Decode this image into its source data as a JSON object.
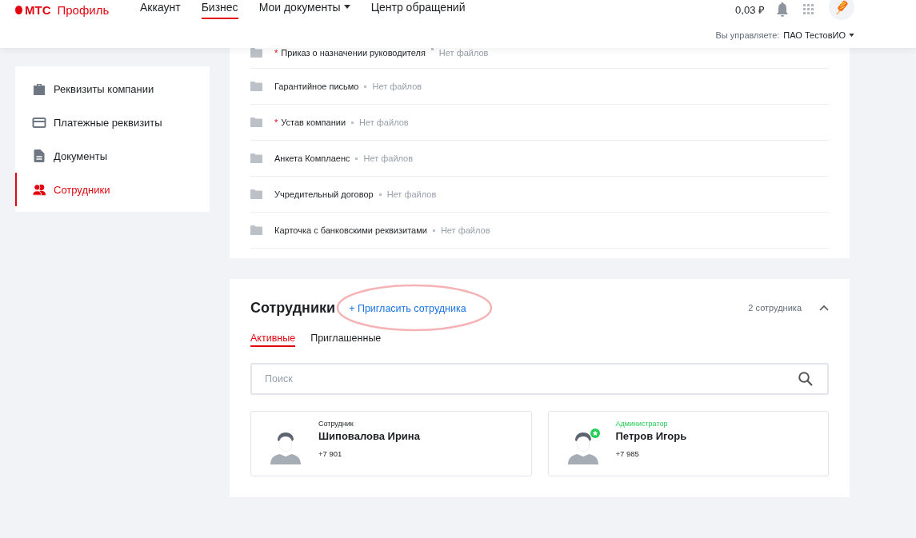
{
  "header": {
    "logo": "МТС",
    "product": "Профиль",
    "nav": [
      {
        "label": "Аккаунт",
        "selected": false,
        "dropdown": false
      },
      {
        "label": "Бизнес",
        "selected": true,
        "dropdown": false
      },
      {
        "label": "Мои документы",
        "selected": false,
        "dropdown": true
      },
      {
        "label": "Центр обращений",
        "selected": false,
        "dropdown": false
      }
    ],
    "balance": "0,03 ₽",
    "manage_label": "Вы управляете:",
    "company": "ПАО ТестовИО"
  },
  "sidebar": {
    "items": [
      {
        "label": "Реквизиты компании",
        "kind": "briefcase",
        "selected": false
      },
      {
        "label": "Платежные реквизиты",
        "kind": "card",
        "selected": false
      },
      {
        "label": "Документы",
        "kind": "document",
        "selected": false
      },
      {
        "label": "Сотрудники",
        "kind": "people",
        "selected": true
      }
    ]
  },
  "documents": [
    {
      "mark": "*",
      "name": "Приказ о назначении руководителя",
      "status": "Нет файлов"
    },
    {
      "name": "Гарантийное письмо",
      "status": "Нет файлов"
    },
    {
      "mark": "*",
      "name": "Устав компании",
      "status": "Нет файлов"
    },
    {
      "name": "Анкета Комплаенс",
      "status": "Нет файлов"
    },
    {
      "name": "Учредительный договор",
      "status": "Нет файлов"
    },
    {
      "name": "Карточка с банковскими реквизитами",
      "status": "Нет файлов"
    }
  ],
  "employees": {
    "title": "Сотрудники",
    "invite": "+ Пригласить сотрудника",
    "invite_circled": true,
    "count": "2 сотрудника",
    "expanded": true,
    "tabs": [
      {
        "label": "Активные",
        "selected": true
      },
      {
        "label": "Приглашенные",
        "selected": false
      }
    ],
    "search": {
      "placeholder": "Поиск"
    },
    "people": [
      {
        "kind": "employee",
        "role": "Сотрудник",
        "name": "Шиповалова Ирина",
        "phone": "+7 901"
      },
      {
        "kind": "admin",
        "role": "Администратор",
        "name": "Петров Игорь",
        "phone": "+7 985"
      }
    ]
  }
}
